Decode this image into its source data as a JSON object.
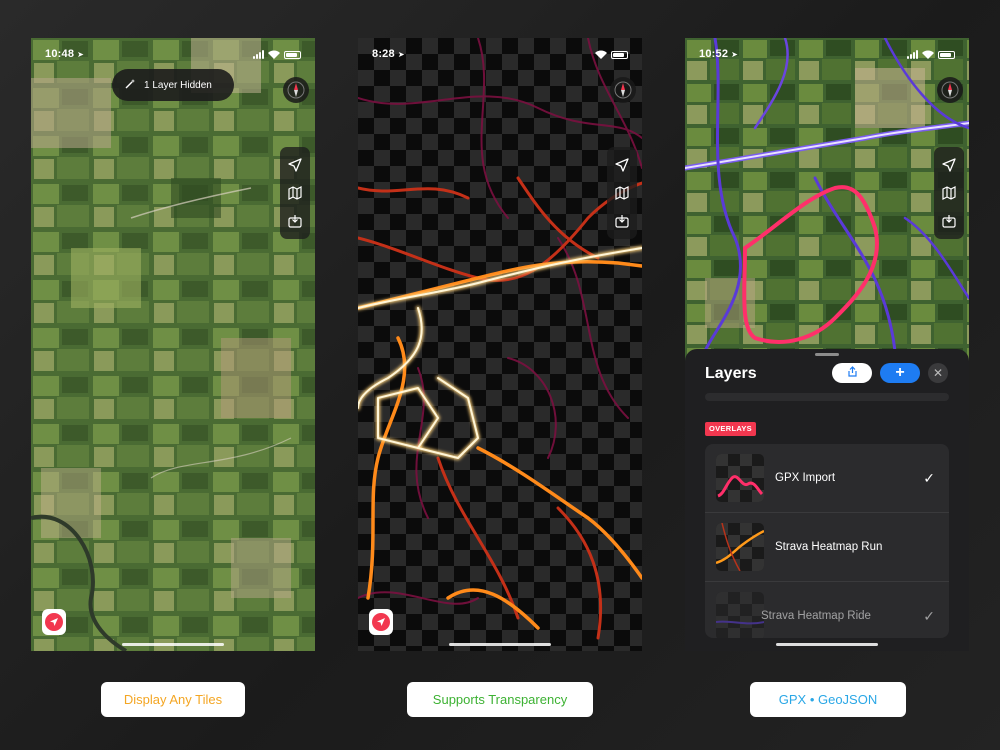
{
  "phones": [
    {
      "time": "10:48",
      "pill_label": "1 Layer Hidden",
      "caption": "Display Any Tiles"
    },
    {
      "time": "8:28",
      "caption": "Supports Transparency"
    },
    {
      "time": "10:52",
      "caption": "GPX • GeoJSON",
      "layers_panel": {
        "title": "Layers",
        "add_label": "+",
        "close_label": "✕",
        "section": "OVERLAYS",
        "items": [
          {
            "label": "GPX Import",
            "check": "✓"
          },
          {
            "label": "Strava Heatmap Run",
            "check": ""
          },
          {
            "label": "Strava Heatmap Ride",
            "check": "✓"
          }
        ]
      }
    }
  ],
  "colors": {
    "accent": "#f2374f",
    "caption1": "#f4a623",
    "caption2": "#3db233",
    "caption3": "#2aa7e6",
    "add_button": "#1e7cf2"
  },
  "icons": [
    "location-arrow-icon",
    "map-icon",
    "download-tray-icon",
    "compass-icon",
    "magic-wand-icon",
    "share-icon",
    "plus-icon",
    "close-icon",
    "checkmark-icon"
  ]
}
